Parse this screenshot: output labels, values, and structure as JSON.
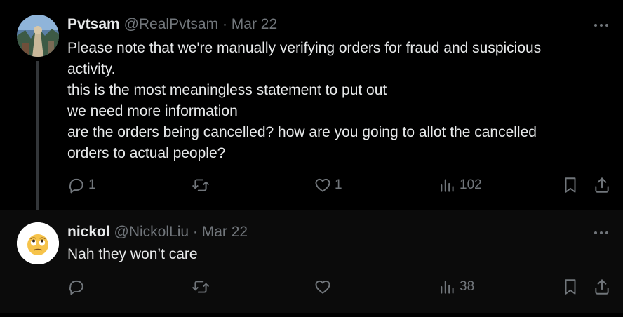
{
  "tweets": [
    {
      "name": "Pvtsam",
      "handle": "@RealPvtsam",
      "sep": "·",
      "date": "Mar 22",
      "text_lines": [
        "Please note that we're manually verifying orders for fraud and suspicious",
        "activity.",
        "this is the most meaningless statement to put out",
        "we need more information",
        "are the orders being cancelled? how are you going to allot the cancelled",
        "orders to actual people?"
      ],
      "replies": "1",
      "retweets": "",
      "likes": "1",
      "views": "102"
    },
    {
      "name": "nickol",
      "handle": "@NickolLiu",
      "sep": "·",
      "date": "Mar 22",
      "text_lines": [
        "Nah they won’t care"
      ],
      "replies": "",
      "retweets": "",
      "likes": "",
      "views": "38",
      "avatar_emoji": "🙄"
    }
  ],
  "colors": {
    "background": "#000000",
    "text": "#e7e9ea",
    "muted": "#71767b"
  },
  "icons": [
    "reply-icon",
    "retweet-icon",
    "like-icon",
    "views-icon",
    "bookmark-icon",
    "share-icon",
    "more-icon"
  ]
}
